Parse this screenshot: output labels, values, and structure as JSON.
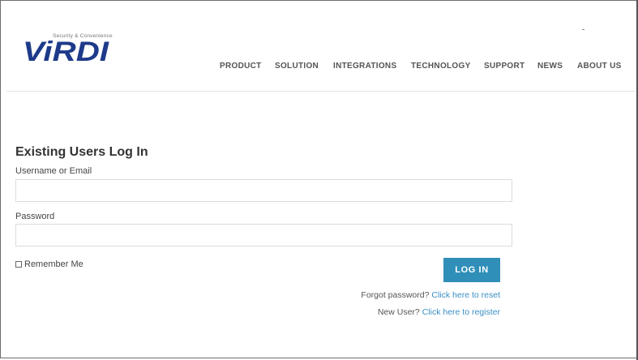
{
  "brand": {
    "logo_text": "ViRDI",
    "tagline": "Security & Convenience"
  },
  "nav": {
    "items": [
      {
        "label": "PRODUCT"
      },
      {
        "label": "SOLUTION"
      },
      {
        "label": "INTEGRATIONS"
      },
      {
        "label": "TECHNOLOGY"
      },
      {
        "label": "SUPPORT"
      },
      {
        "label": "NEWS"
      },
      {
        "label": "ABOUT US"
      }
    ]
  },
  "login": {
    "title": "Existing Users Log In",
    "username_label": "Username or Email",
    "username_value": "",
    "password_label": "Password",
    "password_value": "",
    "remember_label": "Remember Me",
    "remember_checked": false,
    "submit_label": "LOG IN",
    "forgot_prefix": "Forgot password?",
    "forgot_link": "Click here to reset",
    "register_prefix": "New User?",
    "register_link": "Click here to register"
  },
  "colors": {
    "accent": "#2f8fb9",
    "link": "#3a8fc4",
    "logo_blue": "#1e3a8a"
  }
}
